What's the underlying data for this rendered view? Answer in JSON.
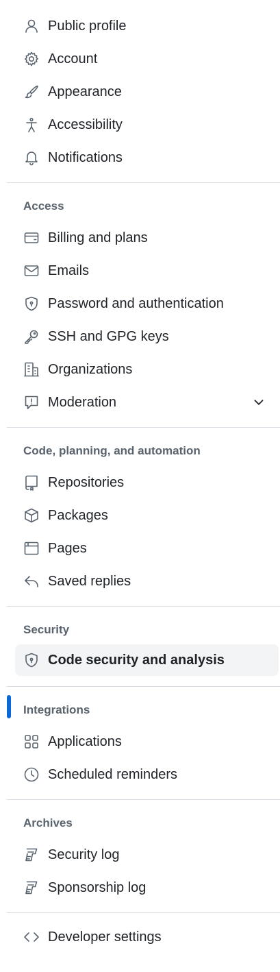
{
  "personal": [
    {
      "label": "Public profile",
      "icon": "person-icon"
    },
    {
      "label": "Account",
      "icon": "gear-icon"
    },
    {
      "label": "Appearance",
      "icon": "paintbrush-icon"
    },
    {
      "label": "Accessibility",
      "icon": "accessibility-icon"
    },
    {
      "label": "Notifications",
      "icon": "bell-icon"
    }
  ],
  "access": {
    "title": "Access",
    "items": [
      {
        "label": "Billing and plans",
        "icon": "credit-card-icon"
      },
      {
        "label": "Emails",
        "icon": "mail-icon"
      },
      {
        "label": "Password and authentication",
        "icon": "shield-lock-icon"
      },
      {
        "label": "SSH and GPG keys",
        "icon": "key-icon"
      },
      {
        "label": "Organizations",
        "icon": "organization-icon"
      },
      {
        "label": "Moderation",
        "icon": "report-icon"
      }
    ]
  },
  "code": {
    "title": "Code, planning, and automation",
    "items": [
      {
        "label": "Repositories",
        "icon": "repo-icon"
      },
      {
        "label": "Packages",
        "icon": "package-icon"
      },
      {
        "label": "Pages",
        "icon": "browser-icon"
      },
      {
        "label": "Saved replies",
        "icon": "reply-icon"
      }
    ]
  },
  "security": {
    "title": "Security",
    "items": [
      {
        "label": "Code security and analysis",
        "icon": "shield-lock-icon",
        "active": true
      }
    ]
  },
  "integrations": {
    "title": "Integrations",
    "items": [
      {
        "label": "Applications",
        "icon": "apps-icon"
      },
      {
        "label": "Scheduled reminders",
        "icon": "clock-icon"
      }
    ]
  },
  "archives": {
    "title": "Archives",
    "items": [
      {
        "label": "Security log",
        "icon": "log-icon"
      },
      {
        "label": "Sponsorship log",
        "icon": "log-icon"
      }
    ]
  },
  "developer": {
    "items": [
      {
        "label": "Developer settings",
        "icon": "code-icon"
      }
    ]
  },
  "colors": {
    "accent": "#0969da",
    "text": "#1f2328",
    "muted": "#59636e",
    "divider": "#d8dee4",
    "active_bg": "#f2f4f6"
  }
}
